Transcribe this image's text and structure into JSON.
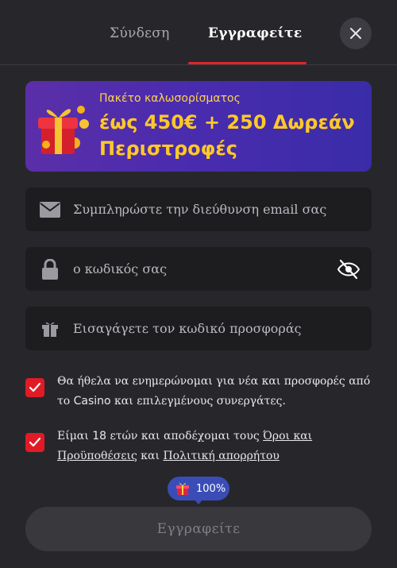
{
  "tabs": {
    "login": "Σύνδεση",
    "register": "Εγγραφείτε"
  },
  "banner": {
    "subtitle": "Πακέτο καλωσορίσματος",
    "title": "έως 450€ + 250 Δωρεάν Περιστροφές"
  },
  "fields": {
    "email_placeholder": "Συμπληρώστε την διεύθυνση email σας",
    "password_placeholder": "ο κωδικός σας",
    "promo_placeholder": "Εισαγάγετε τον κωδικό προσφοράς"
  },
  "consents": {
    "newsletter_text_1": "Θα ήθελα να ενημερώνομαι για νέα και προσφορές από το ",
    "newsletter_brand": "Casino",
    "newsletter_text_2": " και επιλεγμένους συνεργάτες.",
    "age_text_1": "Είμαι ",
    "age_number": "18",
    "age_text_2": " ετών και αποδέχομαι τους ",
    "terms_link": "Όροι και Προϋποθέσεις",
    "age_text_3": " και ",
    "privacy_link": "Πολιτική απορρήτου"
  },
  "progress": {
    "label": "100%",
    "value": 100
  },
  "submit_label": "Εγγραφείτε",
  "colors": {
    "accent": "#e11b26",
    "banner_text": "#ffc928",
    "pill": "#3a4db6"
  }
}
